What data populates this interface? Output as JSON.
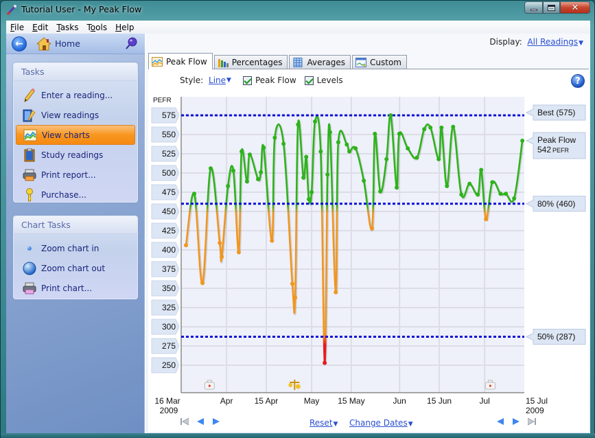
{
  "window": {
    "title": "Tutorial User - My Peak Flow",
    "controls": [
      "minimize",
      "maximize",
      "close"
    ]
  },
  "menu": [
    {
      "label": "File",
      "accel": "F"
    },
    {
      "label": "Edit",
      "accel": "E"
    },
    {
      "label": "Tasks",
      "accel": "T"
    },
    {
      "label": "Tools",
      "accel": "o"
    },
    {
      "label": "Help",
      "accel": "H"
    }
  ],
  "sidebar": {
    "home_label": "Home",
    "tasks": {
      "title": "Tasks",
      "items": [
        {
          "label": "Enter a reading...",
          "icon": "pencil-icon",
          "active": false
        },
        {
          "label": "View readings",
          "icon": "view-readings-icon",
          "active": false
        },
        {
          "label": "View charts",
          "icon": "chart-icon",
          "active": true
        },
        {
          "label": "Study readings",
          "icon": "clipboard-icon",
          "active": false
        },
        {
          "label": "Print report...",
          "icon": "printer-icon",
          "active": false
        },
        {
          "label": "Purchase...",
          "icon": "key-icon",
          "active": false
        }
      ]
    },
    "chart_tasks": {
      "title": "Chart Tasks",
      "items": [
        {
          "label": "Zoom chart in",
          "icon": "zoom-in-icon"
        },
        {
          "label": "Zoom chart out",
          "icon": "zoom-out-icon"
        },
        {
          "label": "Print chart...",
          "icon": "printer-icon"
        }
      ]
    }
  },
  "main": {
    "display_label": "Display:",
    "display_value": "All Readings",
    "tabs": [
      {
        "label": "Peak Flow",
        "active": true,
        "icon": "peak-flow-chart-icon"
      },
      {
        "label": "Percentages",
        "active": false,
        "icon": "bar-chart-icon"
      },
      {
        "label": "Averages",
        "active": false,
        "icon": "table-icon"
      },
      {
        "label": "Custom",
        "active": false,
        "icon": "custom-chart-icon"
      }
    ],
    "style_label": "Style:",
    "style_value": "Line",
    "checkboxes": [
      {
        "label": "Peak Flow",
        "checked": true
      },
      {
        "label": "Levels",
        "checked": true
      }
    ],
    "bottom": {
      "reset_label": "Reset",
      "change_dates_label": "Change Dates"
    }
  },
  "colors": {
    "good": "#2db31a",
    "caution": "#f0961e",
    "danger": "#e81a1a",
    "level_line": "#0a10d8",
    "active_task": "#f7961f",
    "link": "#2a4fd1"
  },
  "chart_data": {
    "type": "line",
    "title": "",
    "ylabel": "PEFR",
    "xlabel": "",
    "ylim": [
      240,
      590
    ],
    "yticks": [
      575,
      550,
      525,
      500,
      475,
      450,
      425,
      400,
      375,
      350,
      325,
      300,
      275,
      250
    ],
    "x_range_days": [
      0,
      121
    ],
    "x_start_date": "16 Mar 2009",
    "xticks": [
      {
        "day": 0,
        "label": "16 Mar",
        "sublabel": "2009"
      },
      {
        "day": 16,
        "label": "Apr",
        "sublabel": ""
      },
      {
        "day": 30,
        "label": "15 Apr",
        "sublabel": ""
      },
      {
        "day": 46,
        "label": "May",
        "sublabel": ""
      },
      {
        "day": 60,
        "label": "15 May",
        "sublabel": ""
      },
      {
        "day": 77,
        "label": "Jun",
        "sublabel": ""
      },
      {
        "day": 91,
        "label": "15 Jun",
        "sublabel": ""
      },
      {
        "day": 107,
        "label": "Jul",
        "sublabel": ""
      },
      {
        "day": 121,
        "label": "15 Jul",
        "sublabel": "2009"
      }
    ],
    "grid": true,
    "levels": [
      {
        "name": "Best",
        "value": 575,
        "label": "Best (575)"
      },
      {
        "name": "80%",
        "value": 460,
        "label": "80% (460)"
      },
      {
        "name": "50%",
        "value": 287,
        "label": "50% (287)"
      }
    ],
    "current": {
      "label": "Peak Flow",
      "value": 542,
      "unit": "PEFR"
    },
    "event_markers": [
      {
        "day": 10,
        "type": "medical-kit"
      },
      {
        "day": 40,
        "type": "scales"
      },
      {
        "day": 109,
        "type": "medical-kit"
      }
    ],
    "series": [
      {
        "name": "Peak Flow",
        "points": [
          [
            1.7,
            406
          ],
          [
            4.6,
            473
          ],
          [
            7.5,
            357
          ],
          [
            10.4,
            506
          ],
          [
            13.6,
            409
          ],
          [
            14.3,
            391
          ],
          [
            16.5,
            483
          ],
          [
            18.4,
            503
          ],
          [
            20.3,
            397
          ],
          [
            21.3,
            528
          ],
          [
            23.2,
            489
          ],
          [
            24.2,
            524
          ],
          [
            27.1,
            492
          ],
          [
            28.1,
            501
          ],
          [
            29.1,
            533
          ],
          [
            32.0,
            412
          ],
          [
            33.0,
            546
          ],
          [
            36.1,
            538
          ],
          [
            39.2,
            356
          ],
          [
            40.2,
            338
          ],
          [
            41.2,
            563
          ],
          [
            43.1,
            494
          ],
          [
            44.1,
            521
          ],
          [
            45.0,
            466
          ],
          [
            46.0,
            475
          ],
          [
            47.2,
            567
          ],
          [
            49.2,
            528
          ],
          [
            50.6,
            253
          ],
          [
            51.6,
            498
          ],
          [
            52.5,
            553
          ],
          [
            54.5,
            345
          ],
          [
            55.4,
            540
          ],
          [
            58.4,
            537
          ],
          [
            59.3,
            528
          ],
          [
            61.5,
            532
          ],
          [
            64.4,
            490
          ],
          [
            67.3,
            428
          ],
          [
            68.3,
            551
          ],
          [
            70.2,
            476
          ],
          [
            72.4,
            518
          ],
          [
            73.9,
            575
          ],
          [
            76.0,
            481
          ],
          [
            76.9,
            551
          ],
          [
            79.9,
            532
          ],
          [
            83.1,
            520
          ],
          [
            85.7,
            557
          ],
          [
            87.9,
            559
          ],
          [
            90.8,
            518
          ],
          [
            91.8,
            559
          ],
          [
            93.7,
            483
          ],
          [
            95.9,
            560
          ],
          [
            98.8,
            472
          ],
          [
            101.7,
            486
          ],
          [
            104.6,
            472
          ],
          [
            105.8,
            504
          ],
          [
            107.5,
            440
          ],
          [
            109.7,
            488
          ],
          [
            112.6,
            473
          ],
          [
            114.5,
            473
          ],
          [
            117.4,
            467
          ],
          [
            120.3,
            542
          ]
        ]
      }
    ]
  }
}
